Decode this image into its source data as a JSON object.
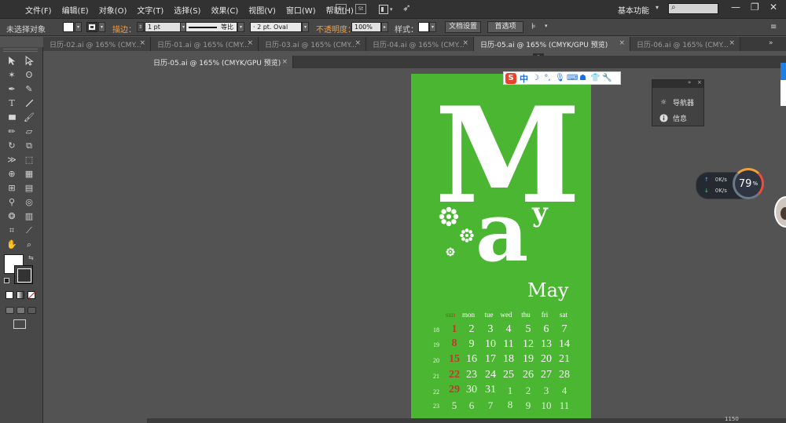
{
  "menubar": {
    "app_logo": "Ai",
    "items": [
      "文件(F)",
      "编辑(E)",
      "对象(O)",
      "文字(T)",
      "选择(S)",
      "效果(C)",
      "视图(V)",
      "窗口(W)",
      "帮助(H)"
    ],
    "bridge": "Br",
    "stock": "St",
    "workspace": "基本功能",
    "window_controls": [
      "—",
      "❐",
      "✕"
    ]
  },
  "controlbar": {
    "selection_label": "未选择对象",
    "stroke_label": "描边：",
    "stroke_weight": "1 pt",
    "profile_label": "等比",
    "brush_label": "· 2 pt. Oval",
    "opacity_label": "不透明度：",
    "opacity_value": "100%",
    "style_label": "样式：",
    "doc_setup": "文档设置",
    "preferences": "首选项"
  },
  "tabs_row1": [
    {
      "label": "日历-02.ai @ 165% (CMY...",
      "active": false
    },
    {
      "label": "日历-01.ai @ 165% (CMY...",
      "active": false
    },
    {
      "label": "日历-03.ai @ 165% (CMY...",
      "active": false
    },
    {
      "label": "日历-04.ai @ 165% (CMY...",
      "active": false
    },
    {
      "label": "日历-05.ai @ 165% (CMYK/GPU 预览)",
      "active": true
    },
    {
      "label": "日历-06.ai @ 165% (CMY...",
      "active": false
    }
  ],
  "tabs_row2": [
    {
      "label": "日历-05.ai @ 165% (CMYK/GPU 预览)",
      "active": true
    }
  ],
  "artwork": {
    "big_letter_1": "M",
    "big_letter_2": "a",
    "big_letter_3": "y",
    "month_title": "May",
    "day_headers": [
      "sun",
      "mon",
      "tue",
      "wed",
      "thu",
      "fri",
      "sat"
    ],
    "weeks": [
      {
        "wk": "18",
        "days": [
          "",
          "1",
          "2",
          "3",
          "4",
          "5",
          "6",
          "7"
        ]
      },
      {
        "wk": "19",
        "days": [
          "8",
          "9",
          "10",
          "11",
          "12",
          "13",
          "14"
        ]
      },
      {
        "wk": "20",
        "days": [
          "15",
          "16",
          "17",
          "18",
          "19",
          "20",
          "21"
        ]
      },
      {
        "wk": "21",
        "days": [
          "22",
          "23",
          "24",
          "25",
          "26",
          "27",
          "28"
        ]
      },
      {
        "wk": "22",
        "days": [
          "29",
          "30",
          "31",
          "1",
          "2",
          "3",
          "4"
        ]
      },
      {
        "wk": "23",
        "days": [
          "5",
          "6",
          "7",
          "8",
          "9",
          "10",
          "11"
        ]
      }
    ],
    "colors": {
      "background": "#4ab632",
      "sunday": "#c0392b",
      "text": "#ffffff"
    }
  },
  "ime": {
    "logo": "S",
    "mode": "中"
  },
  "navpanel": {
    "items": [
      {
        "label": "导航器",
        "icon": "navigator-icon"
      },
      {
        "label": "信息",
        "icon": "info-icon"
      }
    ]
  },
  "netwidget": {
    "upload": "0K/s",
    "download": "0K/s",
    "percent": "79",
    "percent_sign": "%"
  },
  "statusbar": {
    "text": "1150"
  }
}
